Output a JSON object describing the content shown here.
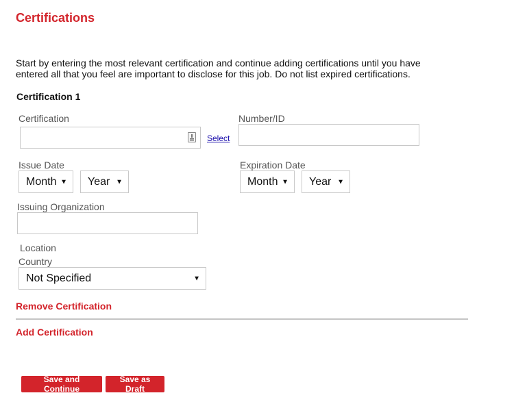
{
  "page": {
    "title": "Certifications",
    "intro": "Start by entering the most relevant certification and continue adding certifications until you have entered all that you feel are important to disclose for this job. Do not list expired certifications."
  },
  "certification": {
    "heading": "Certification 1",
    "certification_label": "Certification",
    "certification_value": "",
    "select_link": "Select",
    "number_label": "Number/ID",
    "number_value": "",
    "issue_date_label": "Issue Date",
    "issue_month": "Month",
    "issue_year": "Year",
    "expiration_date_label": "Expiration Date",
    "expiration_month": "Month",
    "expiration_year": "Year",
    "issuing_org_label": "Issuing Organization",
    "issuing_org_value": "",
    "location_label": "Location",
    "country_label": "Country",
    "country_value": "Not Specified",
    "remove_link": "Remove Certification"
  },
  "actions": {
    "add_link": "Add Certification",
    "save_continue": "Save and Continue",
    "save_draft": "Save as Draft"
  },
  "icons": {
    "dropdown": "caret-down-icon",
    "picker": "picker-icon"
  },
  "colors": {
    "accent": "#d3242b",
    "link": "#1a0dab",
    "border": "#c8c8c8"
  }
}
